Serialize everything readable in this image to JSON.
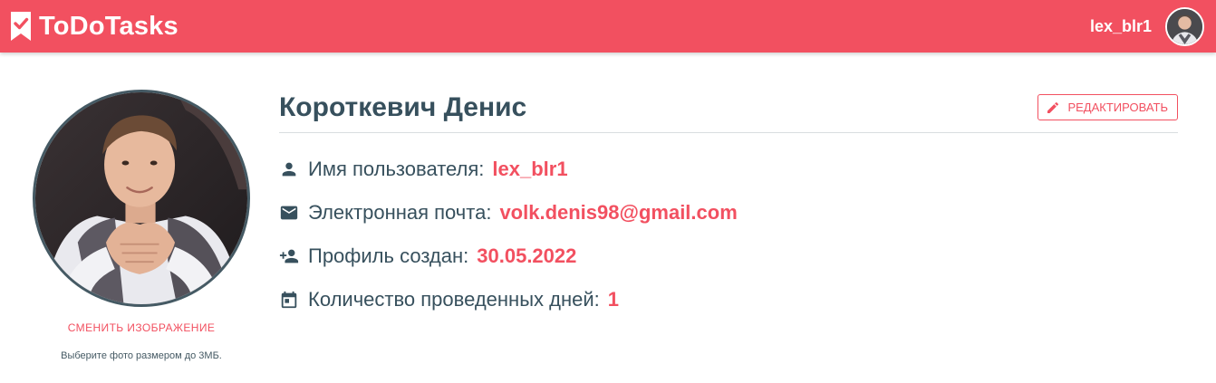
{
  "header": {
    "app_name": "ToDoTasks",
    "username": "lex_blr1",
    "brand_color": "#f25060"
  },
  "profile_photo": {
    "change_label": "СМЕНИТЬ ИЗОБРАЖЕНИЕ",
    "hint": "Выберите фото размером до 3МБ."
  },
  "profile": {
    "full_name": "Короткевич Денис",
    "edit_label": "РЕДАКТИРОВАТЬ",
    "fields": [
      {
        "icon": "person-icon",
        "label": "Имя пользователя:",
        "value": "lex_blr1"
      },
      {
        "icon": "email-icon",
        "label": "Электронная почта:",
        "value": "volk.denis98@gmail.com"
      },
      {
        "icon": "person-add-icon",
        "label": "Профиль создан:",
        "value": "30.05.2022"
      },
      {
        "icon": "calendar-icon",
        "label": "Количество проведенных дней:",
        "value": "1"
      }
    ]
  },
  "colors": {
    "accent": "#f25060",
    "text_dark": "#37505d",
    "divider": "#d9dde0"
  }
}
